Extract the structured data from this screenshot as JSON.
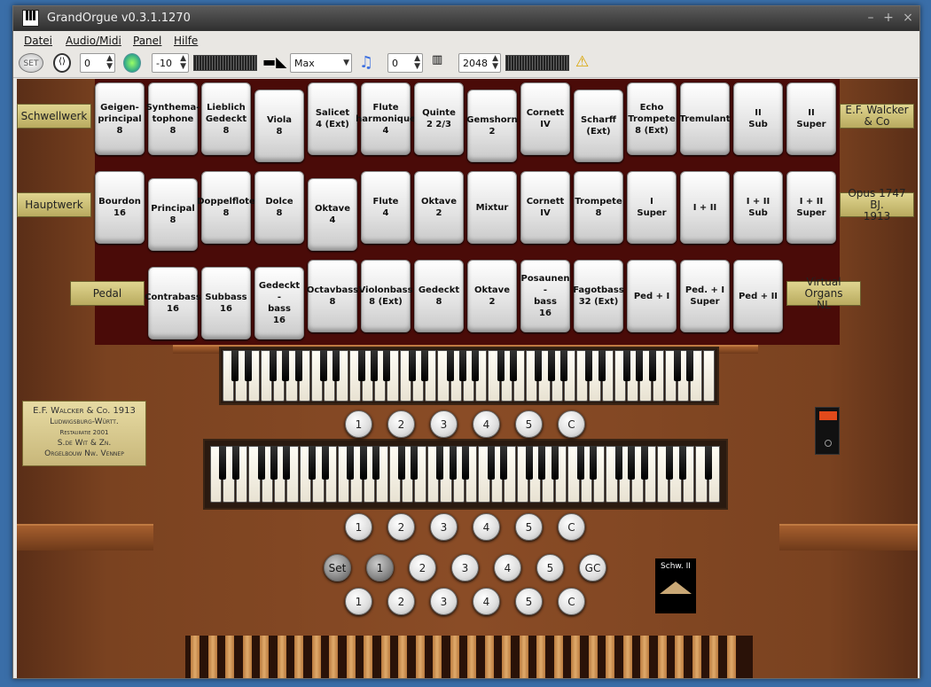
{
  "window": {
    "title": "GrandOrgue v0.3.1.1270"
  },
  "menu": [
    {
      "label": "Datei"
    },
    {
      "label": "Audio/Midi"
    },
    {
      "label": "Panel"
    },
    {
      "label": "Hilfe"
    }
  ],
  "toolbar": {
    "set_label": "SET",
    "memory_value": "0",
    "volume_value": "-10",
    "polyphony_mode": "Max",
    "transpose_value": "0",
    "polyphony_value": "2048"
  },
  "divisions": {
    "schwellwerk": "Schwellwerk",
    "hauptwerk": "Hauptwerk",
    "pedal": "Pedal"
  },
  "builder_labels": {
    "right1": "E.F. Walcker\n& Co",
    "right2": "Opus 1747 BJ.\n1913",
    "right3": "Virtual Organs\nNL"
  },
  "stops_row1": [
    "Geigen-\nprincipal\n8",
    "Synthema-\ntophone\n8",
    "Lieblich\nGedeckt\n8",
    "Viola\n8",
    "Salicet\n4 (Ext)",
    "Flute\nharmonique\n4",
    "Quinte\n2 2/3",
    "Gemshorn\n2",
    "Cornett\nIV",
    "Scharff\n(Ext)",
    "Echo\nTrompete\n8 (Ext)",
    "Tremulant",
    "II\nSub",
    "II\nSuper"
  ],
  "stops_row2": [
    "Bourdon\n16",
    "Principal\n8",
    "Doppelflote\n8",
    "Dolce\n8",
    "Oktave\n4",
    "Flute\n4",
    "Oktave\n2",
    "Mixtur",
    "Cornett\nIV",
    "Trompete\n8",
    "I\nSuper",
    "I + II",
    "I + II\nSub",
    "I + II\nSuper"
  ],
  "stops_row3": [
    "Contrabass\n16",
    "Subbass\n16",
    "Gedeckt -\nbass\n16",
    "Octavbass\n8",
    "Violonbass\n8 (Ext)",
    "Gedeckt\n8",
    "Oktave\n2",
    "Posaunen -\nbass\n16",
    "Fagotbass\n32 (Ext)",
    "Ped + I",
    "Ped. + I\nSuper",
    "Ped + II"
  ],
  "pistons_upper": [
    "1",
    "2",
    "3",
    "4",
    "5",
    "C"
  ],
  "pistons_lower": [
    "1",
    "2",
    "3",
    "4",
    "5",
    "C"
  ],
  "pistons_general": [
    "Set",
    "1",
    "2",
    "3",
    "4",
    "5",
    "GC"
  ],
  "pistons_bottom": [
    "1",
    "2",
    "3",
    "4",
    "5",
    "C"
  ],
  "plaque": {
    "line1": "E.F. Walcker & Co. 1913",
    "line2": "Ludwigsburg-Württ.",
    "line3": "Restauratie 2001",
    "line4": "S.de Wit & Zn.",
    "line5": "Orgelbouw  Nw. Vennep"
  },
  "swell": {
    "label": "Schw. II"
  },
  "colors": {
    "wood": "#7a4220",
    "stop_face": "#f2f2f2",
    "label_gold": "#d4c67e"
  }
}
